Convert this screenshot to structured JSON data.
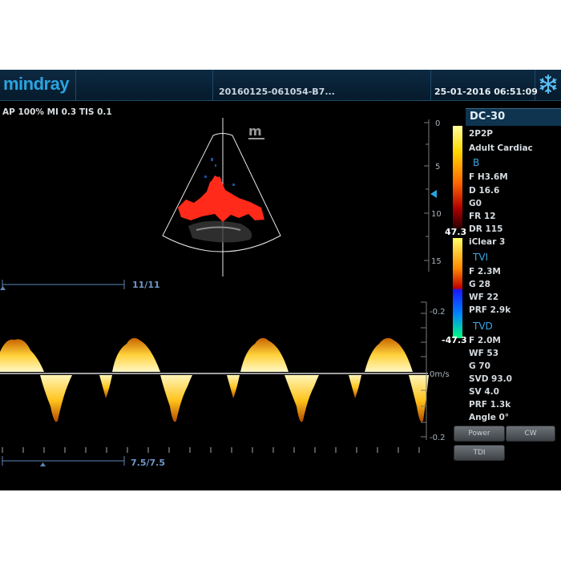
{
  "header": {
    "brand": "mindray",
    "patient_id": "20160125-061054-B7...",
    "datetime": "25-01-2016 06:51:09",
    "freeze_icon": "snowflake-icon"
  },
  "status": {
    "acoustic": "AP 100%  MI 0.3  TIS 0.1"
  },
  "image": {
    "probe_marker": "m",
    "bmode_frame": "11/11",
    "doppler_frame": "7.5/7.5",
    "depth_ticks": [
      "0",
      "5",
      "10",
      "15"
    ],
    "velocity_ticks": [
      "-0.2",
      "0m/s",
      "-0.2"
    ]
  },
  "color_bar": {
    "max": "47.3",
    "min": "-47.3"
  },
  "panel": {
    "preset": "DC-30",
    "probe": "2P2P",
    "exam": "Adult Cardiac",
    "b_title": "B",
    "b_params": [
      "F H3.6M",
      "D 16.6",
      "G0",
      "FR 12",
      "DR 115",
      "iClear 3"
    ],
    "tvi_title": "TVI",
    "tvi_params": [
      "F 2.3M",
      "G 28",
      "WF 22",
      "PRF 2.9k"
    ],
    "tvd_title": "TVD",
    "tvd_params": [
      "F 2.0M",
      "WF 53",
      "G 70",
      "SVD 93.0",
      "SV 4.0",
      "PRF 1.3k",
      "Angle 0°"
    ]
  },
  "buttons": {
    "power": "Power",
    "cw": "CW",
    "tdi": "TDI"
  },
  "colors": {
    "accent": "#2aa3e0",
    "doppler": "#ffb400",
    "color_flow": "#ff2a1a"
  }
}
